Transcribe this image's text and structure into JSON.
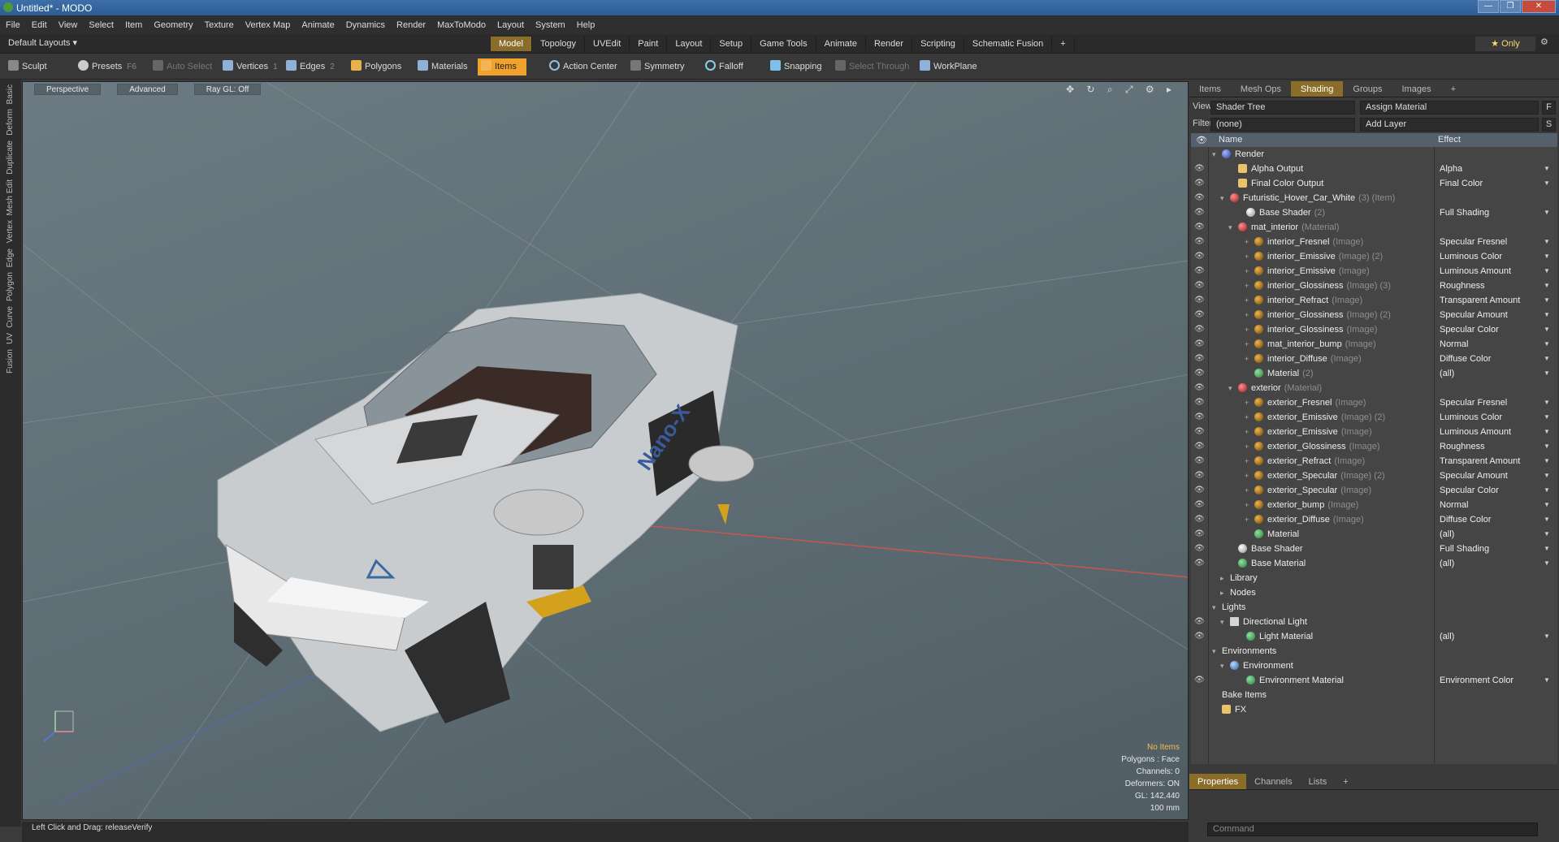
{
  "window": {
    "title": "Untitled* - MODO",
    "buttons": [
      "—",
      "❐",
      "✕"
    ]
  },
  "menu": [
    "File",
    "Edit",
    "View",
    "Select",
    "Item",
    "Geometry",
    "Texture",
    "Vertex Map",
    "Animate",
    "Dynamics",
    "Render",
    "MaxToModo",
    "Layout",
    "System",
    "Help"
  ],
  "layout": {
    "selector": "Default Layouts ▾",
    "tabs": [
      "Model",
      "Topology",
      "UVEdit",
      "Paint",
      "Layout",
      "Setup",
      "Game Tools",
      "Animate",
      "Render",
      "Scripting",
      "Schematic Fusion",
      "+"
    ],
    "active": "Model",
    "only": "★ Only"
  },
  "toolbar": {
    "sculpt": "Sculpt",
    "presets": "Presets",
    "presets_key": "F6",
    "auto_select": "Auto Select",
    "vertices": "Vertices",
    "vertices_key": "1",
    "edges": "Edges",
    "edges_key": "2",
    "polygons": "Polygons",
    "materials": "Materials",
    "items": "Items",
    "action_center": "Action Center",
    "symmetry": "Symmetry",
    "falloff": "Falloff",
    "snapping": "Snapping",
    "select_through": "Select Through",
    "workplane": "WorkPlane"
  },
  "left_tabs": [
    "Basic",
    "Deform",
    "Duplicate",
    "Mesh Edit",
    "Vertex",
    "Edge",
    "Polygon",
    "Curve",
    "UV",
    "Fusion"
  ],
  "viewport": {
    "view": "Perspective",
    "advanced": "Advanced",
    "raygl": "Ray GL: Off",
    "icons": "✥ ↻ ⌕ ⤢ ⚙ ▸",
    "info": {
      "items": "No Items",
      "polygons": "Polygons : Face",
      "channels": "Channels: 0",
      "deformers": "Deformers: ON",
      "gl": "GL: 142,440",
      "scale": "100 mm"
    },
    "car_label": "Nano-X"
  },
  "status": {
    "text": "Left Click and Drag:  releaseVerify"
  },
  "right_panel": {
    "tabs": [
      "Items",
      "Mesh Ops",
      "Shading",
      "Groups",
      "Images",
      "+"
    ],
    "active": "Shading",
    "view_label": "View",
    "view_value": "Shader Tree",
    "assign": "Assign Material",
    "filter_label": "Filter",
    "filter_value": "(none)",
    "add_layer": "Add Layer",
    "btn_f": "F",
    "btn_s": "S",
    "col_name": "Name",
    "col_effect": "Effect",
    "rows": [
      {
        "indent": 0,
        "tog": "▾",
        "icon": "d-ren",
        "name": "Render",
        "gray": "",
        "effect": "",
        "eye": false
      },
      {
        "indent": 2,
        "tog": "",
        "icon": "d-out",
        "name": "Alpha Output",
        "gray": "",
        "effect": "Alpha",
        "eye": true
      },
      {
        "indent": 2,
        "tog": "",
        "icon": "d-out",
        "name": "Final Color Output",
        "gray": "",
        "effect": "Final Color",
        "eye": true
      },
      {
        "indent": 1,
        "tog": "▾",
        "icon": "d-mat2",
        "name": "Futuristic_Hover_Car_White",
        "gray": "(3) (Item)",
        "effect": "",
        "eye": true
      },
      {
        "indent": 3,
        "tog": "",
        "icon": "d-shd",
        "name": "Base Shader",
        "gray": "(2)",
        "effect": "Full Shading",
        "eye": true
      },
      {
        "indent": 2,
        "tog": "▾",
        "icon": "d-mat2",
        "name": "mat_interior",
        "gray": "(Material)",
        "effect": "",
        "eye": true
      },
      {
        "indent": 4,
        "tog": "+",
        "icon": "d-img",
        "name": "interior_Fresnel",
        "gray": "(Image)",
        "effect": "Specular Fresnel",
        "eye": true
      },
      {
        "indent": 4,
        "tog": "+",
        "icon": "d-img",
        "name": "interior_Emissive",
        "gray": "(Image) (2)",
        "effect": "Luminous Color",
        "eye": true
      },
      {
        "indent": 4,
        "tog": "+",
        "icon": "d-img",
        "name": "interior_Emissive",
        "gray": "(Image)",
        "effect": "Luminous Amount",
        "eye": true
      },
      {
        "indent": 4,
        "tog": "+",
        "icon": "d-img",
        "name": "interior_Glossiness",
        "gray": "(Image) (3)",
        "effect": "Roughness",
        "eye": true
      },
      {
        "indent": 4,
        "tog": "+",
        "icon": "d-img",
        "name": "interior_Refract",
        "gray": "(Image)",
        "effect": "Transparent Amount",
        "eye": true
      },
      {
        "indent": 4,
        "tog": "+",
        "icon": "d-img",
        "name": "interior_Glossiness",
        "gray": "(Image) (2)",
        "effect": "Specular Amount",
        "eye": true
      },
      {
        "indent": 4,
        "tog": "+",
        "icon": "d-img",
        "name": "interior_Glossiness",
        "gray": "(Image)",
        "effect": "Specular Color",
        "eye": true
      },
      {
        "indent": 4,
        "tog": "+",
        "icon": "d-img",
        "name": "mat_interior_bump",
        "gray": "(Image)",
        "effect": "Normal",
        "eye": true
      },
      {
        "indent": 4,
        "tog": "+",
        "icon": "d-img",
        "name": "interior_Diffuse",
        "gray": "(Image)",
        "effect": "Diffuse Color",
        "eye": true
      },
      {
        "indent": 4,
        "tog": "",
        "icon": "d-mat",
        "name": "Material",
        "gray": "(2)",
        "effect": "(all)",
        "eye": true
      },
      {
        "indent": 2,
        "tog": "▾",
        "icon": "d-mat2",
        "name": "exterior",
        "gray": "(Material)",
        "effect": "",
        "eye": true
      },
      {
        "indent": 4,
        "tog": "+",
        "icon": "d-img",
        "name": "exterior_Fresnel",
        "gray": "(Image)",
        "effect": "Specular Fresnel",
        "eye": true
      },
      {
        "indent": 4,
        "tog": "+",
        "icon": "d-img",
        "name": "exterior_Emissive",
        "gray": "(Image) (2)",
        "effect": "Luminous Color",
        "eye": true
      },
      {
        "indent": 4,
        "tog": "+",
        "icon": "d-img",
        "name": "exterior_Emissive",
        "gray": "(Image)",
        "effect": "Luminous Amount",
        "eye": true
      },
      {
        "indent": 4,
        "tog": "+",
        "icon": "d-img",
        "name": "exterior_Glossiness",
        "gray": "(Image)",
        "effect": "Roughness",
        "eye": true
      },
      {
        "indent": 4,
        "tog": "+",
        "icon": "d-img",
        "name": "exterior_Refract",
        "gray": "(Image)",
        "effect": "Transparent Amount",
        "eye": true
      },
      {
        "indent": 4,
        "tog": "+",
        "icon": "d-img",
        "name": "exterior_Specular",
        "gray": "(Image) (2)",
        "effect": "Specular Amount",
        "eye": true
      },
      {
        "indent": 4,
        "tog": "+",
        "icon": "d-img",
        "name": "exterior_Specular",
        "gray": "(Image)",
        "effect": "Specular Color",
        "eye": true
      },
      {
        "indent": 4,
        "tog": "+",
        "icon": "d-img",
        "name": "exterior_bump",
        "gray": "(Image)",
        "effect": "Normal",
        "eye": true
      },
      {
        "indent": 4,
        "tog": "+",
        "icon": "d-img",
        "name": "exterior_Diffuse",
        "gray": "(Image)",
        "effect": "Diffuse Color",
        "eye": true
      },
      {
        "indent": 4,
        "tog": "",
        "icon": "d-mat",
        "name": "Material",
        "gray": "",
        "effect": "(all)",
        "eye": true
      },
      {
        "indent": 2,
        "tog": "",
        "icon": "d-shd",
        "name": "Base Shader",
        "gray": "",
        "effect": "Full Shading",
        "eye": true
      },
      {
        "indent": 2,
        "tog": "",
        "icon": "d-mat",
        "name": "Base Material",
        "gray": "",
        "effect": "(all)",
        "eye": true
      },
      {
        "indent": 1,
        "tog": "▸",
        "icon": "",
        "name": "Library",
        "gray": "",
        "effect": "",
        "eye": false
      },
      {
        "indent": 1,
        "tog": "▸",
        "icon": "",
        "name": "Nodes",
        "gray": "",
        "effect": "",
        "eye": false
      },
      {
        "indent": 0,
        "tog": "▾",
        "icon": "",
        "name": "Lights",
        "gray": "",
        "effect": "",
        "eye": false
      },
      {
        "indent": 1,
        "tog": "▾",
        "icon": "d-light",
        "name": "Directional Light",
        "gray": "",
        "effect": "",
        "eye": true
      },
      {
        "indent": 3,
        "tog": "",
        "icon": "d-mat",
        "name": "Light Material",
        "gray": "",
        "effect": "(all)",
        "eye": true
      },
      {
        "indent": 0,
        "tog": "▾",
        "icon": "",
        "name": "Environments",
        "gray": "",
        "effect": "",
        "eye": false
      },
      {
        "indent": 1,
        "tog": "▾",
        "icon": "d-env",
        "name": "Environment",
        "gray": "",
        "effect": "",
        "eye": false
      },
      {
        "indent": 3,
        "tog": "",
        "icon": "d-mat",
        "name": "Environment Material",
        "gray": "",
        "effect": "Environment Color",
        "eye": true
      },
      {
        "indent": 0,
        "tog": "",
        "icon": "",
        "name": "Bake Items",
        "gray": "",
        "effect": "",
        "eye": false
      },
      {
        "indent": 0,
        "tog": "",
        "icon": "d-out",
        "name": "FX",
        "gray": "",
        "effect": "",
        "eye": false
      }
    ]
  },
  "bottom_panel": {
    "tabs": [
      "Properties",
      "Channels",
      "Lists",
      "+"
    ],
    "active": "Properties",
    "command_placeholder": "Command"
  }
}
